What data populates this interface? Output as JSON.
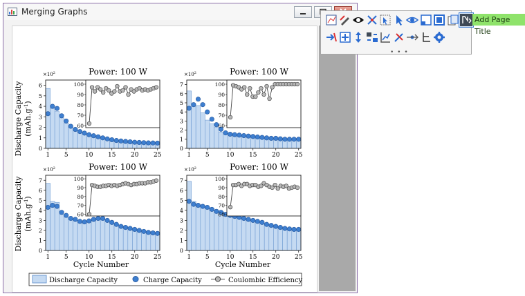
{
  "window": {
    "title": "Merging Graphs"
  },
  "toolbar": {
    "tooltip": "Add Page Title",
    "more_indicator": "• • •",
    "icons": [
      "merge-graph-icon",
      "edit-icon",
      "show-hide-icon",
      "rescale-icon",
      "cursor-icon",
      "select-icon",
      "eye-icon",
      "layer-icon",
      "frame-icon",
      "copy-format-icon",
      "add-title-icon",
      "arrange-icon",
      "zoom-icon",
      "move-icon",
      "swap-icon",
      "align-icon",
      "tools-icon",
      "link-icon",
      "tree-icon",
      "settings-icon"
    ]
  },
  "figure": {
    "ylabel_line1": "Discharge Capacity",
    "ylabel_line2": "(mAh.g",
    "ylabel_sup": "-1",
    "ylabel_close": ")",
    "xlabel": "Cycle Number",
    "legend": {
      "bar": "Discharge Capacity",
      "charge": "Charge Capacity",
      "ce": "Coulombic Efficiency"
    },
    "multiplier": "×10",
    "multiplier_exp": "2"
  },
  "chart_data": [
    {
      "type": "bar",
      "title": "Power: 100 W",
      "xlim": [
        0.5,
        25.5
      ],
      "ylim": [
        0,
        6.5
      ],
      "xticks": [
        1,
        5,
        10,
        15,
        20,
        25
      ],
      "yticks": [
        0,
        1,
        2,
        3,
        4,
        5,
        6
      ],
      "x": [
        1,
        2,
        3,
        4,
        5,
        6,
        7,
        8,
        9,
        10,
        11,
        12,
        13,
        14,
        15,
        16,
        17,
        18,
        19,
        20,
        21,
        22,
        23,
        24,
        25
      ],
      "series": [
        {
          "name": "Discharge Capacity",
          "values": [
            5.7,
            3.8,
            3.5,
            2.9,
            2.4,
            2.0,
            1.7,
            1.5,
            1.35,
            1.25,
            1.15,
            1.05,
            0.95,
            0.85,
            0.78,
            0.72,
            0.68,
            0.64,
            0.6,
            0.57,
            0.55,
            0.53,
            0.52,
            0.51,
            0.5
          ]
        },
        {
          "name": "Charge Capacity",
          "values": [
            3.3,
            4.0,
            3.8,
            3.1,
            2.6,
            2.1,
            1.8,
            1.6,
            1.45,
            1.3,
            1.2,
            1.1,
            1.0,
            0.9,
            0.82,
            0.75,
            0.7,
            0.66,
            0.62,
            0.58,
            0.56,
            0.54,
            0.52,
            0.51,
            0.5
          ]
        }
      ],
      "inset": {
        "name": "Coulombic Efficiency",
        "ylim": [
          58,
          104
        ],
        "yticks": [
          60,
          70,
          80,
          90,
          100
        ],
        "values": [
          62,
          97,
          93,
          97,
          95,
          92,
          96,
          94,
          91,
          93,
          98,
          93,
          94,
          97,
          90,
          95,
          93,
          95,
          96,
          94,
          95,
          94,
          95,
          96,
          97
        ]
      }
    },
    {
      "type": "bar",
      "title": "Power: 100 W",
      "xlim": [
        0.5,
        25.5
      ],
      "ylim": [
        0,
        7.5
      ],
      "xticks": [
        1,
        5,
        10,
        15,
        20,
        25
      ],
      "yticks": [
        0,
        1,
        2,
        3,
        4,
        5,
        6,
        7
      ],
      "x": [
        1,
        2,
        3,
        4,
        5,
        6,
        7,
        8,
        9,
        10,
        11,
        12,
        13,
        14,
        15,
        16,
        17,
        18,
        19,
        20,
        21,
        22,
        23,
        24,
        25
      ],
      "series": [
        {
          "name": "Discharge Capacity",
          "values": [
            6.3,
            4.6,
            4.7,
            3.9,
            3.1,
            2.7,
            2.3,
            1.8,
            1.6,
            1.5,
            1.45,
            1.4,
            1.35,
            1.3,
            1.25,
            1.2,
            1.15,
            1.1,
            1.1,
            1.05,
            1.05,
            1.0,
            1.0,
            1.0,
            0.95
          ]
        },
        {
          "name": "Charge Capacity",
          "values": [
            4.4,
            4.8,
            5.4,
            4.8,
            4.0,
            3.2,
            2.6,
            2.1,
            1.7,
            1.55,
            1.5,
            1.45,
            1.4,
            1.35,
            1.3,
            1.25,
            1.2,
            1.15,
            1.1,
            1.1,
            1.05,
            1.0,
            1.0,
            1.0,
            1.0
          ]
        }
      ],
      "inset": {
        "name": "Coulombic Efficiency",
        "ylim": [
          58,
          104
        ],
        "yticks": [
          60,
          70,
          80,
          90,
          100
        ],
        "values": [
          68,
          99,
          98,
          97,
          95,
          97,
          90,
          96,
          88,
          88,
          92,
          96,
          90,
          98,
          86,
          97,
          100,
          100,
          100,
          100,
          100,
          100,
          100,
          100,
          100
        ]
      }
    },
    {
      "type": "bar",
      "title": "Power: 100 W",
      "xlim": [
        0.5,
        25.5
      ],
      "ylim": [
        0,
        7.5
      ],
      "xticks": [
        1,
        5,
        10,
        15,
        20,
        25
      ],
      "yticks": [
        0,
        1,
        2,
        3,
        4,
        5,
        6,
        7
      ],
      "x": [
        1,
        2,
        3,
        4,
        5,
        6,
        7,
        8,
        9,
        10,
        11,
        12,
        13,
        14,
        15,
        16,
        17,
        18,
        19,
        20,
        21,
        22,
        23,
        24,
        25
      ],
      "series": [
        {
          "name": "Discharge Capacity",
          "values": [
            6.7,
            4.9,
            4.8,
            3.6,
            3.3,
            3.1,
            3.0,
            2.9,
            2.85,
            2.9,
            3.0,
            3.2,
            3.1,
            3.0,
            2.8,
            2.6,
            2.4,
            2.3,
            2.2,
            2.1,
            2.0,
            1.9,
            1.85,
            1.8,
            1.75
          ]
        },
        {
          "name": "Charge Capacity",
          "values": [
            4.3,
            4.5,
            4.4,
            3.8,
            3.5,
            3.2,
            3.1,
            2.9,
            2.85,
            2.95,
            3.1,
            3.2,
            3.2,
            3.0,
            2.8,
            2.6,
            2.4,
            2.3,
            2.2,
            2.1,
            2.0,
            1.9,
            1.8,
            1.75,
            1.7
          ]
        }
      ],
      "inset": {
        "name": "Coulombic Efficiency",
        "ylim": [
          58,
          104
        ],
        "yticks": [
          60,
          70,
          80,
          90,
          100
        ],
        "values": [
          60,
          93,
          92,
          91,
          91,
          92,
          92,
          93,
          92,
          93,
          92,
          93,
          94,
          95,
          94,
          93,
          94,
          94,
          95,
          95,
          95,
          96,
          96,
          97,
          98
        ]
      }
    },
    {
      "type": "bar",
      "title": "Power: 100 W",
      "xlim": [
        0.5,
        25.5
      ],
      "ylim": [
        0,
        7.5
      ],
      "xticks": [
        1,
        5,
        10,
        15,
        20,
        25
      ],
      "yticks": [
        0,
        1,
        2,
        3,
        4,
        5,
        6,
        7
      ],
      "x": [
        1,
        2,
        3,
        4,
        5,
        6,
        7,
        8,
        9,
        10,
        11,
        12,
        13,
        14,
        15,
        16,
        17,
        18,
        19,
        20,
        21,
        22,
        23,
        24,
        25
      ],
      "series": [
        {
          "name": "Discharge Capacity",
          "values": [
            6.9,
            4.9,
            4.5,
            4.4,
            4.3,
            4.2,
            4.0,
            3.9,
            3.8,
            3.6,
            3.45,
            3.35,
            3.2,
            3.1,
            3.0,
            2.9,
            2.8,
            2.6,
            2.5,
            2.4,
            2.3,
            2.25,
            2.2,
            2.15,
            2.1
          ]
        },
        {
          "name": "Charge Capacity",
          "values": [
            4.9,
            4.6,
            4.5,
            4.4,
            4.3,
            4.1,
            3.9,
            3.8,
            3.6,
            3.5,
            3.4,
            3.3,
            3.2,
            3.1,
            3.0,
            2.9,
            2.8,
            2.6,
            2.5,
            2.4,
            2.3,
            2.2,
            2.15,
            2.1,
            2.1
          ]
        }
      ],
      "inset": {
        "name": "Coulombic Efficiency",
        "ylim": [
          58,
          104
        ],
        "yticks": [
          60,
          70,
          80,
          90,
          100
        ],
        "values": [
          68,
          93,
          93,
          94,
          92,
          94,
          94,
          92,
          93,
          93,
          91,
          92,
          95,
          93,
          91,
          90,
          93,
          89,
          92,
          91,
          92,
          89,
          90,
          91,
          90
        ]
      }
    }
  ]
}
